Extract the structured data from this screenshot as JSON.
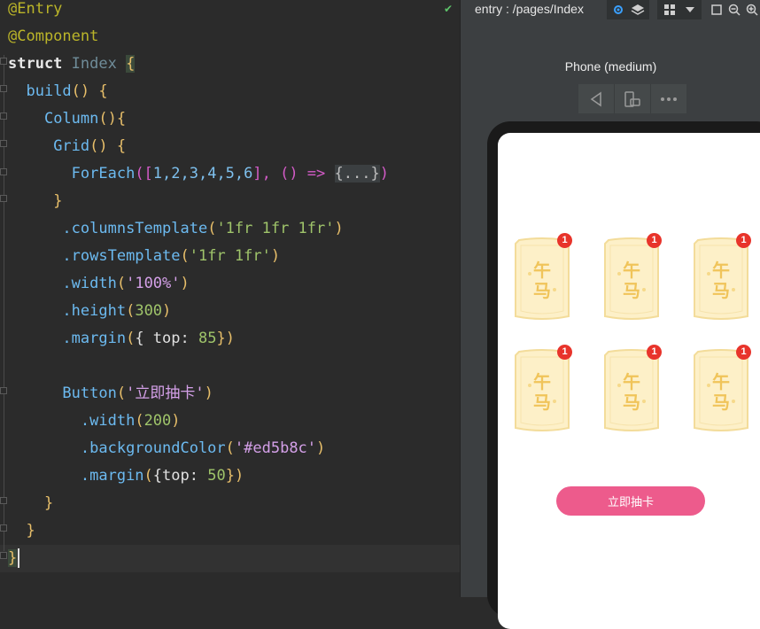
{
  "editor": {
    "lines": {
      "l1": "@Entry",
      "l2": "@Component",
      "l3_kw": "struct",
      "l3_name": "Index",
      "l3_brace": "{",
      "l4_fn": "build",
      "l4_rest": "() {",
      "l5_fn": "Column",
      "l5_rest": "(){",
      "l6_fn": "Grid",
      "l6_rest": "() {",
      "l7_fn": "ForEach",
      "l7_open": "([",
      "l7_nums": "1,2,3,4,5,6",
      "l7_mid": "], () => ",
      "l7_fold": "{...}",
      "l7_close": ")",
      "l8": "}",
      "l9_fn": ".columnsTemplate",
      "l9_arg": "'1fr 1fr 1fr'",
      "l10_fn": ".rowsTemplate",
      "l10_arg": "'1fr 1fr'",
      "l11_fn": ".width",
      "l11_arg": "'100%'",
      "l12_fn": ".height",
      "l12_arg": "300",
      "l13_fn": ".margin",
      "l13_key": "{ top: ",
      "l13_val": "85",
      "l13_end": "})",
      "l15_fn": "Button",
      "l15_arg": "'立即抽卡'",
      "l16_fn": ".width",
      "l16_arg": "200",
      "l17_fn": ".backgroundColor",
      "l17_arg": "'#ed5b8c'",
      "l18_fn": ".margin",
      "l18_key": "{top: ",
      "l18_val": "50",
      "l18_end": "})",
      "l19": "}",
      "l20": "}",
      "l21": "}"
    },
    "status_icon": "check-icon"
  },
  "previewer": {
    "page_path": "entry : /pages/Index",
    "device_name": "Phone (medium)",
    "toolbar_icons": [
      "inspector-icon",
      "layers-icon",
      "grid-icon",
      "dropdown-icon",
      "crop-icon",
      "zoom-out-icon",
      "zoom-in-icon"
    ],
    "device_controls": [
      "back-icon",
      "rotate-icon",
      "more-icon"
    ]
  },
  "app": {
    "cards": [
      {
        "glyph_top": "午",
        "glyph_bottom": "马",
        "badge": "1"
      },
      {
        "glyph_top": "午",
        "glyph_bottom": "马",
        "badge": "1"
      },
      {
        "glyph_top": "午",
        "glyph_bottom": "马",
        "badge": "1"
      },
      {
        "glyph_top": "午",
        "glyph_bottom": "马",
        "badge": "1"
      },
      {
        "glyph_top": "午",
        "glyph_bottom": "马",
        "badge": "1"
      },
      {
        "glyph_top": "午",
        "glyph_bottom": "马",
        "badge": "1"
      }
    ],
    "button_label": "立即抽卡",
    "colors": {
      "button": "#ed5b8c",
      "badge": "#e8342b",
      "card_fill": "#fdf0c8",
      "card_text": "#f0c45a"
    }
  }
}
